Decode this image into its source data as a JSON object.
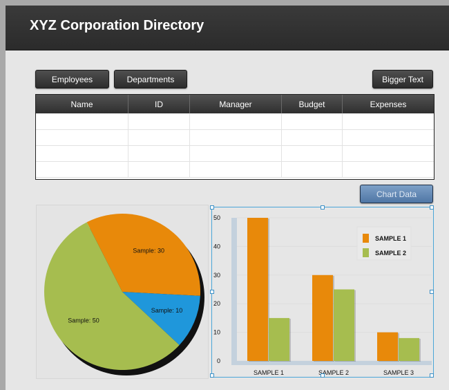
{
  "app": {
    "title": "XYZ Corporation Directory"
  },
  "buttons": {
    "employees": "Employees",
    "departments": "Departments",
    "bigger_text": "Bigger Text",
    "chart_data": "Chart Data"
  },
  "table": {
    "columns": [
      "Name",
      "ID",
      "Manager",
      "Budget",
      "Expenses"
    ],
    "rows": [
      [
        "",
        "",
        "",
        "",
        ""
      ],
      [
        "",
        "",
        "",
        "",
        ""
      ],
      [
        "",
        "",
        "",
        "",
        ""
      ],
      [
        "",
        "",
        "",
        "",
        ""
      ]
    ]
  },
  "colors": {
    "orange": "#e8890a",
    "green": "#a6bd4f",
    "blue": "#1f97db"
  },
  "chart_data": [
    {
      "type": "pie",
      "slices": [
        {
          "label": "Sample: 30",
          "value": 30,
          "color": "#e8890a"
        },
        {
          "label": "Sample: 10",
          "value": 10,
          "color": "#1f97db"
        },
        {
          "label": "Sample: 50",
          "value": 50,
          "color": "#a6bd4f"
        }
      ]
    },
    {
      "type": "bar",
      "categories": [
        "SAMPLE 1",
        "SAMPLE 2",
        "SAMPLE 3"
      ],
      "series": [
        {
          "name": "SAMPLE 1",
          "values": [
            50,
            30,
            10
          ],
          "color": "#e8890a"
        },
        {
          "name": "SAMPLE 2",
          "values": [
            15,
            25,
            8
          ],
          "color": "#a6bd4f"
        }
      ],
      "yticks": [
        0,
        10,
        20,
        30,
        40,
        50
      ],
      "ylim": [
        0,
        50
      ],
      "legend": "top-right",
      "grid": true
    }
  ]
}
